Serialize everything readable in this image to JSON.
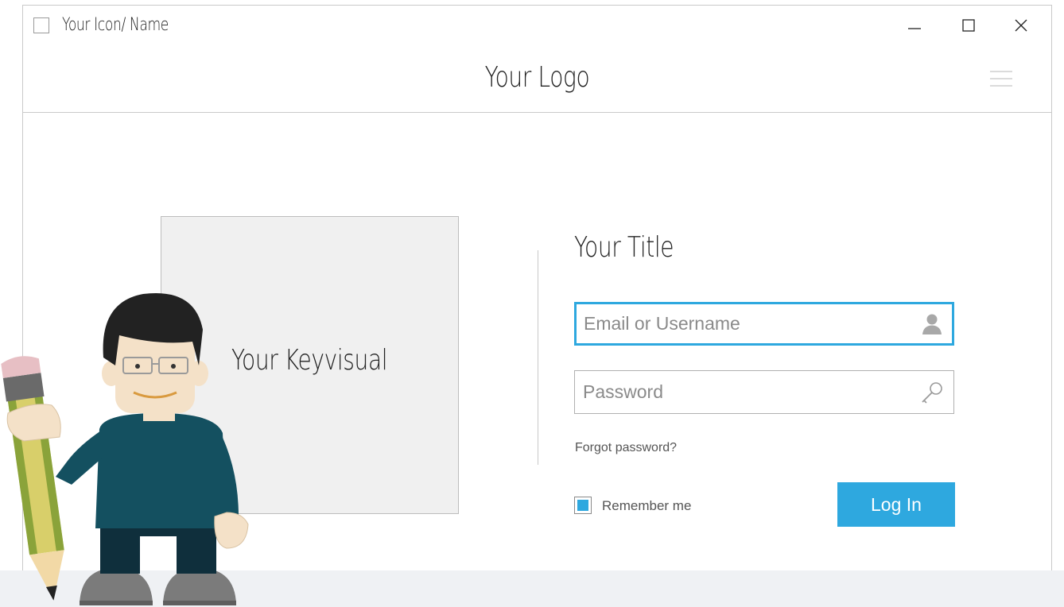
{
  "window": {
    "app_name": "Your Icon/ Name",
    "controls": {
      "minimize_icon": "minimize-icon",
      "maximize_icon": "maximize-icon",
      "close_icon": "close-icon"
    }
  },
  "header": {
    "logo_text": "Your Logo",
    "menu_icon": "hamburger-menu-icon"
  },
  "keyvisual": {
    "label": "Your Keyvisual"
  },
  "form": {
    "title": "Your Title",
    "email_placeholder": "Email or Username",
    "email_icon": "user-icon",
    "password_placeholder": "Password",
    "password_icon": "key-icon",
    "forgot_password": "Forgot password?",
    "remember_me": "Remember me",
    "remember_checked": true,
    "login_button": "Log In"
  },
  "colors": {
    "accent": "#2ea8df",
    "border": "#c9c9c9",
    "keyvisual_bg": "#f0f0f0",
    "footer_band": "#eff1f4"
  },
  "illustration": {
    "subject": "cartoon-man-holding-pencil"
  }
}
